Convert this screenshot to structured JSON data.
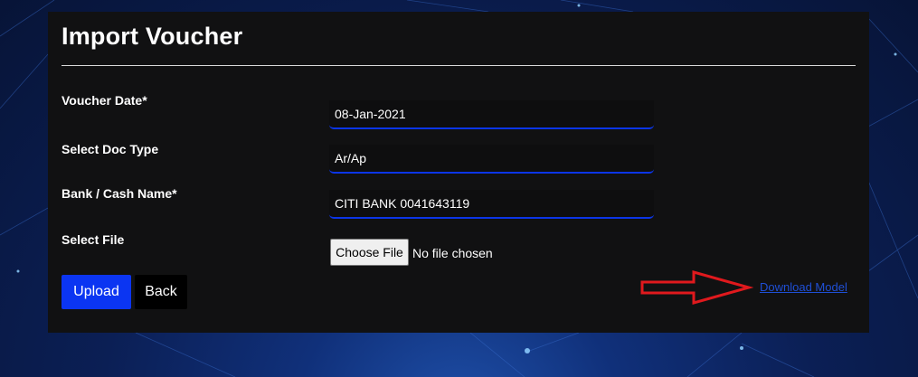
{
  "page": {
    "title": "Import Voucher"
  },
  "form": {
    "voucher_date": {
      "label": "Voucher Date*",
      "value": "08-Jan-2021"
    },
    "doc_type": {
      "label": "Select Doc Type",
      "value": "Ar/Ap"
    },
    "bank_cash": {
      "label": "Bank / Cash Name*",
      "value": "CITI BANK 0041643119"
    },
    "file": {
      "label": "Select File",
      "button_label": "Choose File",
      "status": "No file chosen"
    }
  },
  "actions": {
    "upload_label": "Upload",
    "back_label": "Back",
    "download_label": "Download Model"
  },
  "annotation": {
    "arrow_icon": "red-outline-arrow-right",
    "arrow_color": "#e0191d"
  },
  "colors": {
    "accent": "#0b35f2",
    "link": "#1f4fd6",
    "card_bg": "#111112"
  }
}
